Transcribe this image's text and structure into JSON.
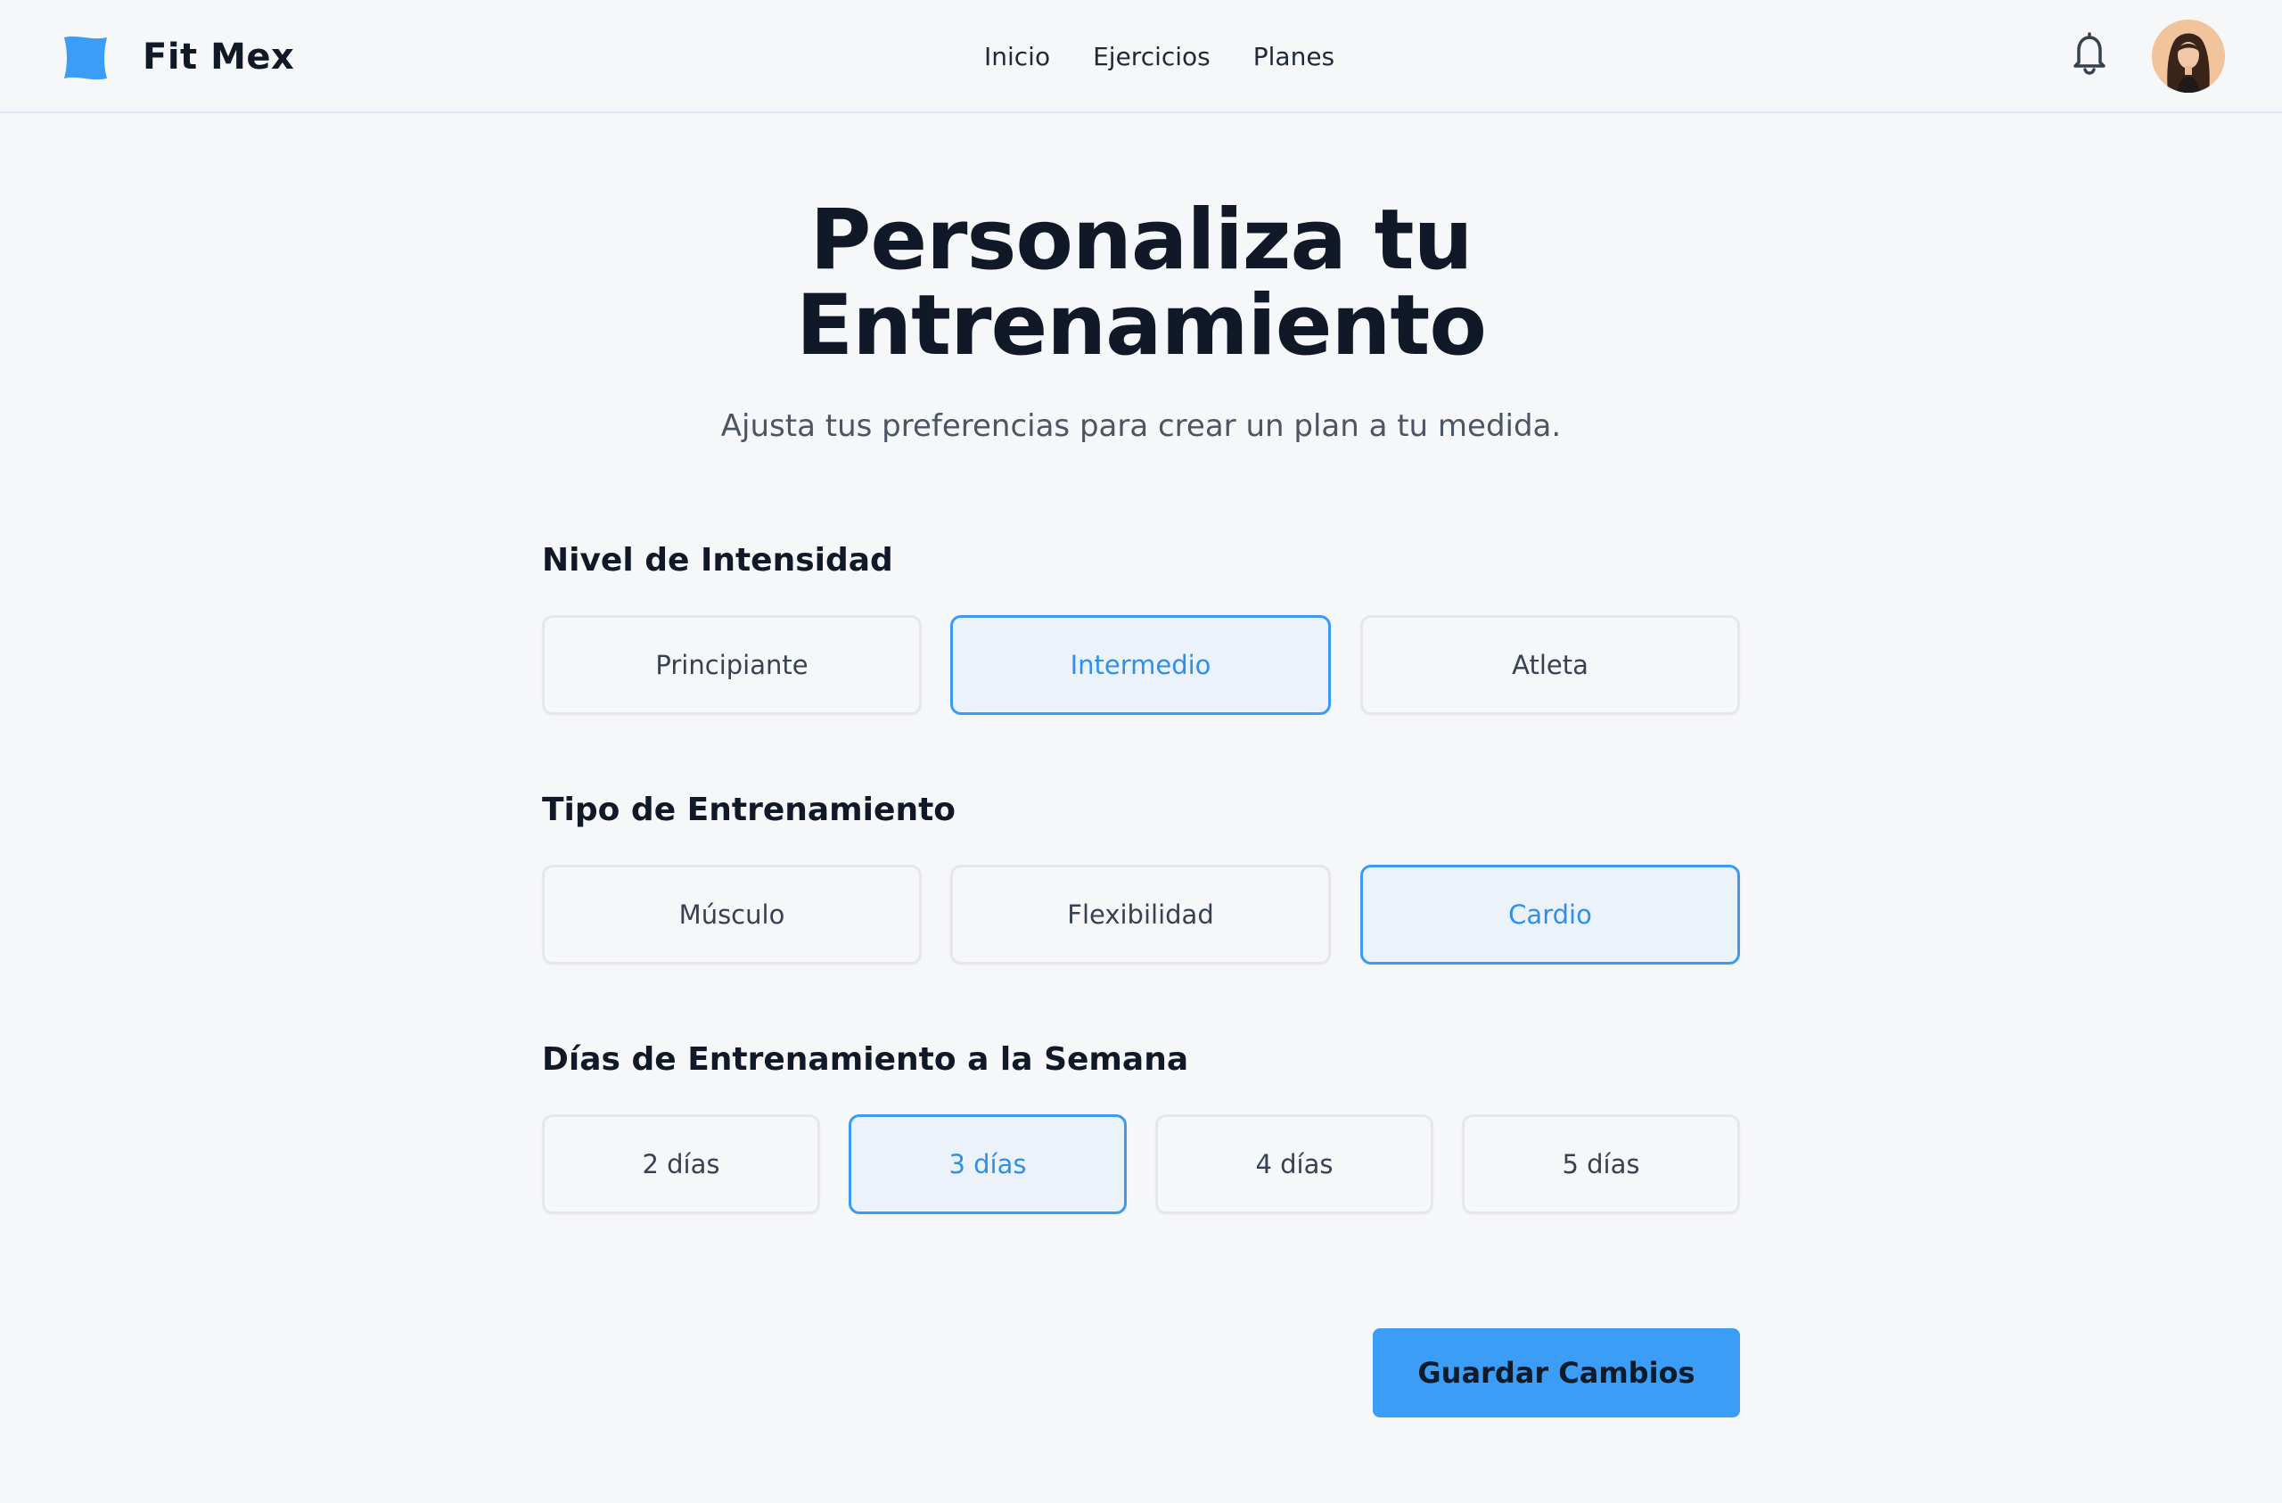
{
  "header": {
    "brand": "Fit Mex",
    "nav": [
      "Inicio",
      "Ejercicios",
      "Planes"
    ],
    "icons": {
      "logo": "logo-mark-icon",
      "notifications": "bell-icon",
      "avatar": "user-avatar"
    }
  },
  "main": {
    "title_line1": "Personaliza tu",
    "title_line2": "Entrenamiento",
    "subtitle": "Ajusta tus preferencias para crear un plan a tu medida."
  },
  "intensity": {
    "heading": "Nivel de Intensidad",
    "options": [
      "Principiante",
      "Intermedio",
      "Atleta"
    ],
    "selected": "Intermedio"
  },
  "training_type": {
    "heading": "Tipo de Entrenamiento",
    "options": [
      "Músculo",
      "Flexibilidad",
      "Cardio"
    ],
    "selected": "Cardio"
  },
  "days": {
    "heading": "Días de Entrenamiento a la Semana",
    "options": [
      "2 días",
      "3 días",
      "4 días",
      "5 días"
    ],
    "selected": "3 días"
  },
  "actions": {
    "save_label": "Guardar Cambios"
  },
  "colors": {
    "accent": "#3b9df6",
    "selected_bg": "#ebf2fa",
    "text_dark": "#111827",
    "background": "#f6f7f9"
  }
}
